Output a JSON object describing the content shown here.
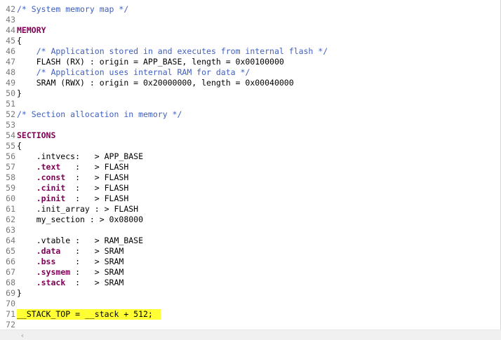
{
  "editor": {
    "lines": [
      {
        "n": "42",
        "segments": [
          {
            "t": "/* System memory map */",
            "c": "comment"
          }
        ]
      },
      {
        "n": "43",
        "segments": []
      },
      {
        "n": "44",
        "segments": [
          {
            "t": "MEMORY",
            "c": "kw"
          }
        ]
      },
      {
        "n": "45",
        "segments": [
          {
            "t": "{",
            "c": "txt"
          }
        ]
      },
      {
        "n": "46",
        "segments": [
          {
            "t": "    ",
            "c": "txt"
          },
          {
            "t": "/* Application stored in and executes from internal flash */",
            "c": "comment"
          }
        ]
      },
      {
        "n": "47",
        "segments": [
          {
            "t": "    FLASH (RX) : origin = APP_BASE, length = 0x00100000",
            "c": "txt"
          }
        ]
      },
      {
        "n": "48",
        "segments": [
          {
            "t": "    ",
            "c": "txt"
          },
          {
            "t": "/* Application uses internal RAM for data */",
            "c": "comment"
          }
        ]
      },
      {
        "n": "49",
        "segments": [
          {
            "t": "    SRAM (RWX) : origin = 0x20000000, length = 0x00040000",
            "c": "txt"
          }
        ]
      },
      {
        "n": "50",
        "segments": [
          {
            "t": "}",
            "c": "txt"
          }
        ]
      },
      {
        "n": "51",
        "segments": []
      },
      {
        "n": "52",
        "segments": [
          {
            "t": "/* Section allocation in memory */",
            "c": "comment"
          }
        ]
      },
      {
        "n": "53",
        "segments": []
      },
      {
        "n": "54",
        "segments": [
          {
            "t": "SECTIONS",
            "c": "kw"
          }
        ]
      },
      {
        "n": "55",
        "segments": [
          {
            "t": "{",
            "c": "txt"
          }
        ]
      },
      {
        "n": "56",
        "segments": [
          {
            "t": "    .intvecs:   > APP_BASE",
            "c": "txt"
          }
        ]
      },
      {
        "n": "57",
        "segments": [
          {
            "t": "    ",
            "c": "txt"
          },
          {
            "t": ".text",
            "c": "kw"
          },
          {
            "t": "   :   > FLASH",
            "c": "txt"
          }
        ]
      },
      {
        "n": "58",
        "segments": [
          {
            "t": "    ",
            "c": "txt"
          },
          {
            "t": ".const",
            "c": "kw"
          },
          {
            "t": "  :   > FLASH",
            "c": "txt"
          }
        ]
      },
      {
        "n": "59",
        "segments": [
          {
            "t": "    ",
            "c": "txt"
          },
          {
            "t": ".cinit",
            "c": "kw"
          },
          {
            "t": "  :   > FLASH",
            "c": "txt"
          }
        ]
      },
      {
        "n": "60",
        "segments": [
          {
            "t": "    ",
            "c": "txt"
          },
          {
            "t": ".pinit",
            "c": "kw"
          },
          {
            "t": "  :   > FLASH",
            "c": "txt"
          }
        ]
      },
      {
        "n": "61",
        "segments": [
          {
            "t": "    .init_array : > FLASH",
            "c": "txt"
          }
        ]
      },
      {
        "n": "62",
        "segments": [
          {
            "t": "    my_section : > 0x08000",
            "c": "txt"
          }
        ]
      },
      {
        "n": "63",
        "segments": []
      },
      {
        "n": "64",
        "segments": [
          {
            "t": "    .vtable :   > RAM_BASE",
            "c": "txt"
          }
        ]
      },
      {
        "n": "65",
        "segments": [
          {
            "t": "    ",
            "c": "txt"
          },
          {
            "t": ".data",
            "c": "kw"
          },
          {
            "t": "   :   > SRAM",
            "c": "txt"
          }
        ]
      },
      {
        "n": "66",
        "segments": [
          {
            "t": "    ",
            "c": "txt"
          },
          {
            "t": ".bss",
            "c": "kw"
          },
          {
            "t": "    :   > SRAM",
            "c": "txt"
          }
        ]
      },
      {
        "n": "67",
        "segments": [
          {
            "t": "    ",
            "c": "txt"
          },
          {
            "t": ".sysmem",
            "c": "kw"
          },
          {
            "t": " :   > SRAM",
            "c": "txt"
          }
        ]
      },
      {
        "n": "68",
        "segments": [
          {
            "t": "    ",
            "c": "txt"
          },
          {
            "t": ".stack",
            "c": "kw"
          },
          {
            "t": "  :   > SRAM",
            "c": "txt"
          }
        ]
      },
      {
        "n": "69",
        "segments": [
          {
            "t": "}",
            "c": "txt"
          }
        ]
      },
      {
        "n": "70",
        "segments": []
      },
      {
        "n": "71",
        "highlight": true,
        "segments": [
          {
            "t": "__STACK_TOP = __stack + 512;",
            "c": "txt"
          }
        ]
      },
      {
        "n": "72",
        "segments": []
      }
    ],
    "highlight_color": "#ffff33"
  },
  "scrollbar": {
    "left_arrow": "‹"
  }
}
